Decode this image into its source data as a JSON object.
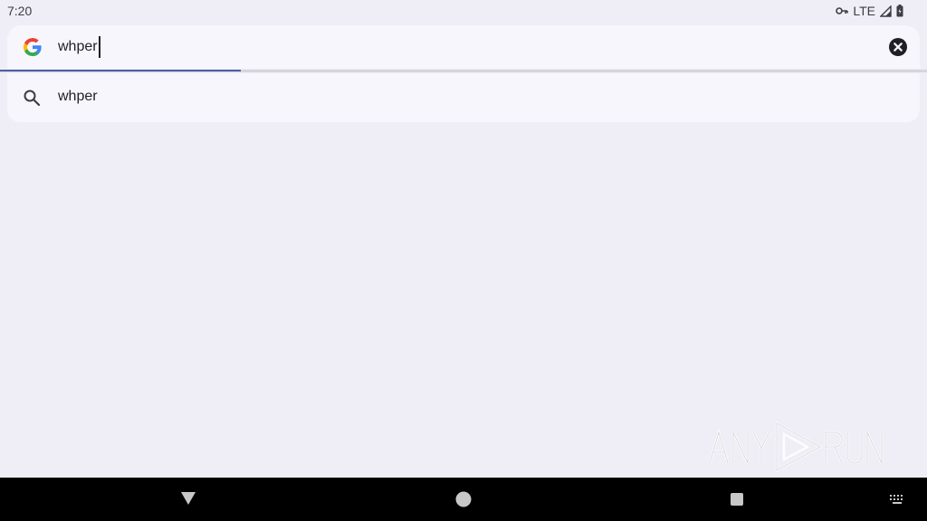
{
  "status_bar": {
    "time": "7:20",
    "network": "LTE",
    "icons": [
      "vpn-key-icon",
      "signal-icon",
      "battery-icon"
    ]
  },
  "search": {
    "query": "whper",
    "logo": "google-g-icon",
    "clear_icon": "clear-circle-icon",
    "progress": 0.26
  },
  "suggestions": [
    {
      "icon": "search-icon",
      "label": "whper"
    }
  ],
  "watermark": {
    "text": "ANY RUN"
  },
  "nav_bar": {
    "buttons": [
      "back-icon",
      "home-icon",
      "recents-icon",
      "keyboard-icon"
    ]
  },
  "colors": {
    "background": "#efeef6",
    "surface": "#f7f6fd",
    "progress": "#4a5fa6",
    "nav": "#000000"
  }
}
